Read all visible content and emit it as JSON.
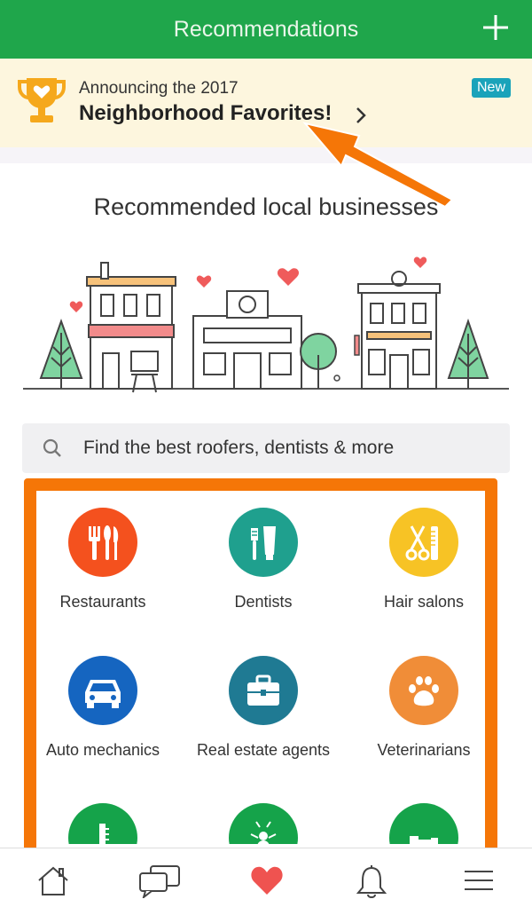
{
  "header": {
    "title": "Recommendations",
    "add_icon": "plus-icon"
  },
  "banner": {
    "announce": "Announcing the 2017",
    "headline": "Neighborhood Favorites!",
    "badge": "New",
    "icon": "trophy-icon"
  },
  "main": {
    "heading": "Recommended local businesses"
  },
  "search": {
    "placeholder": "Find the best roofers, dentists & more",
    "icon": "search-icon"
  },
  "categories": [
    {
      "label": "Restaurants",
      "color": "#f4511e",
      "icon": "utensils-icon"
    },
    {
      "label": "Dentists",
      "color": "#1fa08e",
      "icon": "toothbrush-icon"
    },
    {
      "label": "Hair salons",
      "color": "#f7c325",
      "icon": "scissors-comb-icon"
    },
    {
      "label": "Auto mechanics",
      "color": "#1565c0",
      "icon": "car-icon"
    },
    {
      "label": "Real estate agents",
      "color": "#1f7a93",
      "icon": "briefcase-icon"
    },
    {
      "label": "Veterinarians",
      "color": "#f08d38",
      "icon": "paw-icon"
    },
    {
      "label": "",
      "color": "#15a34a",
      "icon": "thermometer-icon"
    },
    {
      "label": "",
      "color": "#15a34a",
      "icon": "ant-icon"
    },
    {
      "label": "",
      "color": "#15a34a",
      "icon": "pipe-icon"
    }
  ],
  "tabs": [
    {
      "name": "home",
      "icon": "home-icon"
    },
    {
      "name": "messages",
      "icon": "chat-icon"
    },
    {
      "name": "recommendations",
      "icon": "heart-icon",
      "active_color": "#ef5350"
    },
    {
      "name": "notifications",
      "icon": "bell-icon"
    },
    {
      "name": "menu",
      "icon": "menu-icon"
    }
  ],
  "colors": {
    "brand_green": "#1fa64b",
    "highlight_orange": "#f57607",
    "banner_bg": "#fdf6de"
  }
}
